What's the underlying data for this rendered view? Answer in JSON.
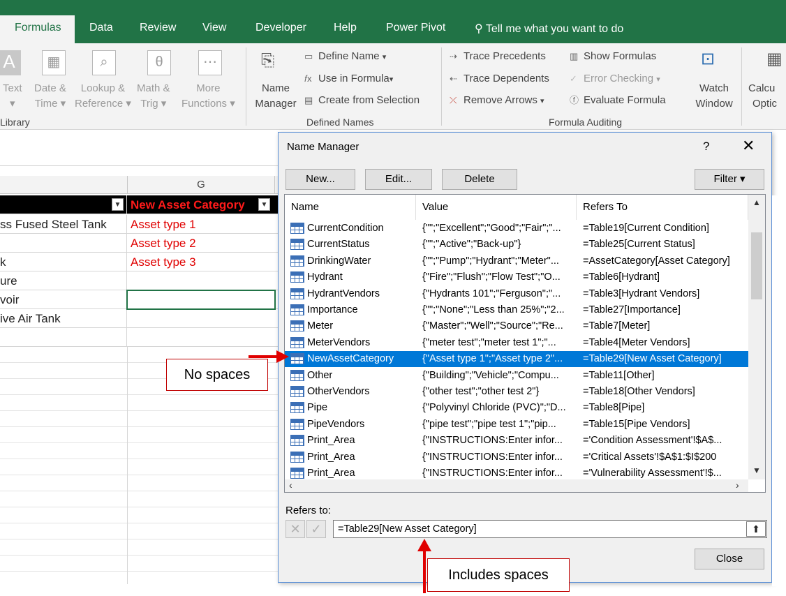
{
  "tabs": [
    "Formulas",
    "Data",
    "Review",
    "View",
    "Developer",
    "Help",
    "Power Pivot"
  ],
  "tell_me": "Tell me what you want to do",
  "ribbon": {
    "functions": {
      "text": "Text",
      "text2": "▾",
      "datetime": "Date &",
      "datetime2": "Time ▾",
      "lookup": "Lookup &",
      "lookup2": "Reference ▾",
      "math": "Math &",
      "math2": "Trig ▾",
      "more": "More",
      "more2": "Functions ▾",
      "group": "Library"
    },
    "names": {
      "name_manager": "Name",
      "name_manager2": "Manager",
      "define_name": "Define Name",
      "use_in_formula": "Use in Formula",
      "create_from_selection": "Create from Selection",
      "group": "Defined Names"
    },
    "auditing": {
      "trace_precedents": "Trace Precedents",
      "trace_dependents": "Trace Dependents",
      "remove_arrows": "Remove Arrows",
      "show_formulas": "Show Formulas",
      "error_checking": "Error Checking",
      "evaluate_formula": "Evaluate Formula",
      "watch_window": "Watch",
      "watch_window2": "Window",
      "group": "Formula Auditing"
    },
    "calc": {
      "label": "Calcu",
      "label2": "Optic"
    }
  },
  "sheet": {
    "column_g": "G",
    "rows": [
      {
        "a": "",
        "b": "New Asset Category"
      },
      {
        "a": "ss Fused Steel Tank",
        "b": "Asset type 1"
      },
      {
        "a": "",
        "b": "Asset type 2"
      },
      {
        "a": "k",
        "b": "Asset type 3"
      },
      {
        "a": "ure",
        "b": ""
      },
      {
        "a": "voir",
        "b": ""
      },
      {
        "a": "ive Air Tank",
        "b": ""
      },
      {
        "a": "",
        "b": ""
      }
    ]
  },
  "dialog": {
    "title": "Name Manager",
    "help": "?",
    "close": "✕",
    "buttons": {
      "new": "New...",
      "edit": "Edit...",
      "delete": "Delete",
      "filter": "Filter ▾",
      "close": "Close"
    },
    "columns": [
      "Name",
      "Value",
      "Refers To"
    ],
    "rows": [
      {
        "name": "CurrentCondition",
        "value": "{\"\";\"Excellent\";\"Good\";\"Fair\";\"...",
        "refers": "=Table19[Current Condition]"
      },
      {
        "name": "CurrentStatus",
        "value": "{\"\";\"Active\";\"Back-up\"}",
        "refers": "=Table25[Current Status]"
      },
      {
        "name": "DrinkingWater",
        "value": "{\"\";\"Pump\";\"Hydrant\";\"Meter\"...",
        "refers": "=AssetCategory[Asset Category]"
      },
      {
        "name": "Hydrant",
        "value": "{\"Fire\";\"Flush\";\"Flow Test\";\"O...",
        "refers": "=Table6[Hydrant]"
      },
      {
        "name": "HydrantVendors",
        "value": "{\"Hydrants 101\";\"Ferguson\";\"...",
        "refers": "=Table3[Hydrant Vendors]"
      },
      {
        "name": "Importance",
        "value": "{\"\";\"None\";\"Less than 25%\";\"2...",
        "refers": "=Table27[Importance]"
      },
      {
        "name": "Meter",
        "value": "{\"Master\";\"Well\";\"Source\";\"Re...",
        "refers": "=Table7[Meter]"
      },
      {
        "name": "MeterVendors",
        "value": "{\"meter test\";\"meter test 1\";\"...",
        "refers": "=Table4[Meter Vendors]"
      },
      {
        "name": "NewAssetCategory",
        "value": "{\"Asset type 1\";\"Asset type 2\"...",
        "refers": "=Table29[New Asset Category]",
        "selected": true
      },
      {
        "name": "Other",
        "value": "{\"Building\";\"Vehicle\";\"Compu...",
        "refers": "=Table11[Other]"
      },
      {
        "name": "OtherVendors",
        "value": "{\"other test\";\"other test 2\"}",
        "refers": "=Table18[Other Vendors]"
      },
      {
        "name": "Pipe",
        "value": "{\"Polyvinyl Chloride (PVC)\";\"D...",
        "refers": "=Table8[Pipe]"
      },
      {
        "name": "PipeVendors",
        "value": "{\"pipe test\";\"pipe test 1\";\"pip...",
        "refers": "=Table15[Pipe Vendors]"
      },
      {
        "name": "Print_Area",
        "value": "{\"INSTRUCTIONS:Enter infor...",
        "refers": "='Condition Assessment'!$A$..."
      },
      {
        "name": "Print_Area",
        "value": "{\"INSTRUCTIONS:Enter infor...",
        "refers": "='Critical Assets'!$A$1:$I$200"
      },
      {
        "name": "Print_Area",
        "value": "{\"INSTRUCTIONS:Enter infor...",
        "refers": "='Vulnerability Assessment'!$..."
      }
    ],
    "refers_to_label": "Refers to:",
    "refers_to_value": "=Table29[New Asset Category]"
  },
  "callouts": {
    "no_spaces": "No spaces",
    "includes_spaces": "Includes spaces"
  },
  "colors": {
    "excel_green": "#217346",
    "selection_blue": "#0078d7",
    "callout_red": "#e00000"
  }
}
